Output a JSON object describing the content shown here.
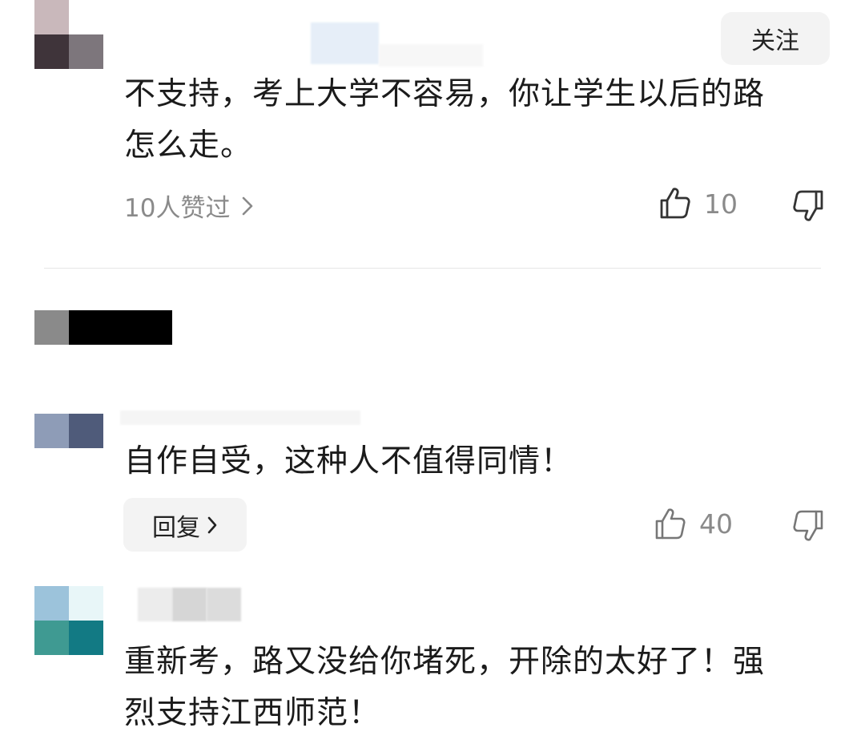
{
  "comments": [
    {
      "text_line1": "不支持，考上大学不容易，你让学生以后的路",
      "text_line2": "怎么走。",
      "likers_label": "10人赞过",
      "likes": "10",
      "follow_label": "关注"
    },
    {
      "text_line1": "自作自受，这种人不值得同情！",
      "reply_label": "回复",
      "likes": "40"
    },
    {
      "text_line1": "重新考，路又没给你堵死，开除的太好了！强",
      "text_line2": "烈支持江西师范！"
    }
  ],
  "colors": {
    "accent_text": "#1b1b1b",
    "muted_text": "#8a8a8a",
    "button_bg": "#f3f3f3"
  },
  "icons": [
    "thumbs-up-icon",
    "thumbs-down-icon",
    "chevron-right-icon"
  ]
}
